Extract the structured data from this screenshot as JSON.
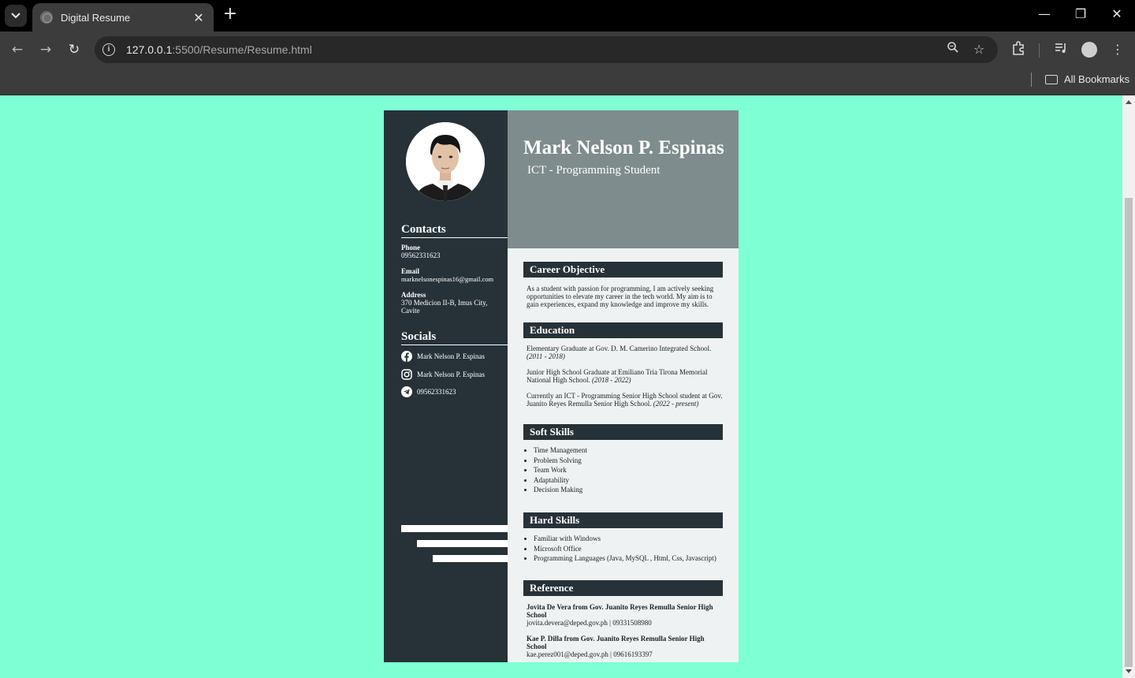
{
  "browser": {
    "tab_title": "Digital Resume",
    "url_host": "127.0.0.1",
    "url_rest": ":5500/Resume/Resume.html",
    "bookmarks_label": "All Bookmarks"
  },
  "resume": {
    "name": "Mark Nelson P. Espinas",
    "role": "ICT - Programming Student",
    "contacts_heading": "Contacts",
    "phone_label": "Phone",
    "phone": "09562331623",
    "email_label": "Email",
    "email": "marknelsonespinas16@gmail.com",
    "address_label": "Address",
    "address": "370 Medicion II-B, Imus City, Cavite",
    "socials_heading": "Socials",
    "socials": [
      {
        "icon": "facebook-icon",
        "text": "Mark Nelson P. Espinas"
      },
      {
        "icon": "instagram-icon",
        "text": "Mark Nelson P. Espinas"
      },
      {
        "icon": "telegram-icon",
        "text": "09562331623"
      }
    ],
    "career_heading": "Career Objective",
    "career_text": "As a student with passion for programming, I am actively seeking opportunities to elevate my career in the tech world. My aim is to gain experiences, expand my knowledge and improve my skills.",
    "education_heading": "Education",
    "education": [
      {
        "text": "Elementary Graduate at Gov. D. M. Camerino Integrated School.",
        "years": "(2011 - 2018)"
      },
      {
        "text": "Junior High School Graduate at Emiliano Tria Tirona Memorial National High School.",
        "years": "(2018 - 2022)"
      },
      {
        "text": "Currently an ICT - Programming Senior High School student at Gov. Juanito Reyes Remulla Senior High School.",
        "years": "(2022 - present)"
      }
    ],
    "soft_heading": "Soft Skills",
    "soft_skills": [
      "Time Management",
      "Problem Solving",
      "Team Work",
      "Adaptability",
      "Decision Making"
    ],
    "hard_heading": "Hard Skills",
    "hard_skills": [
      "Familiar with Windows",
      "Microsoft Office",
      "Programming Languages (Java, MySQL , Html, Css, Javascript)"
    ],
    "reference_heading": "Reference",
    "references": [
      {
        "name": "Jovita De Vera from Gov. Juanito Reyes Remulla Senior High School",
        "contact": "jovita.devera@deped.gov.ph | 09331508980"
      },
      {
        "name": "Kae P. Dilla from Gov. Juanito Reyes Remulla Senior High School",
        "contact": "kae.perez001@deped.gov.ph | 09616193397"
      }
    ]
  },
  "colors": {
    "page_bg": "#7fffd4",
    "sidebar_bg": "#263238",
    "header_bg": "#7f8c8d",
    "main_bg": "#eef2f3"
  }
}
